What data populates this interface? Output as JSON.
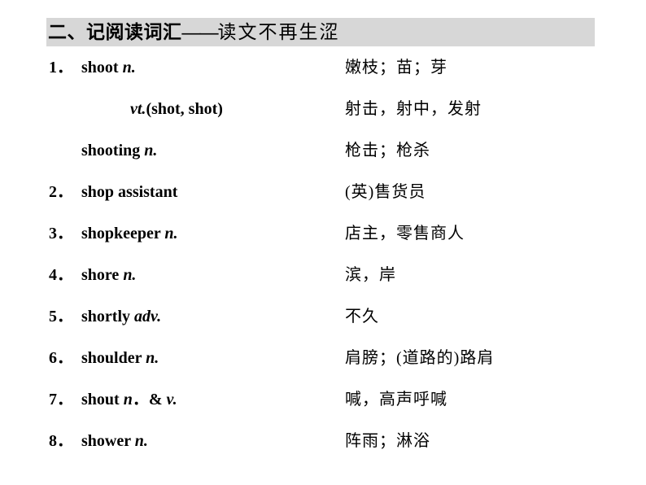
{
  "slide": {
    "title": {
      "head": "二、记阅读词汇",
      "dash": "——",
      "tail": "读文不再生涩",
      "band_color": "#d7d7d7"
    },
    "entries": [
      {
        "number": "1．",
        "english_word": "shoot",
        "part_of_speech": "n.",
        "chinese": "嫩枝；苗；芽"
      },
      {
        "number": "",
        "english_word": "",
        "part_of_speech": "vt.",
        "extra": "(shot, shot)",
        "chinese": "射击，射中，发射"
      },
      {
        "number": "",
        "english_word": "shooting",
        "part_of_speech": "n.",
        "chinese": "枪击；枪杀"
      },
      {
        "number": "2．",
        "english_word": "shop assistant",
        "part_of_speech": "",
        "chinese": "(英)售货员"
      },
      {
        "number": "3．",
        "english_word": "shopkeeper",
        "part_of_speech": "n.",
        "chinese": "店主，零售商人"
      },
      {
        "number": "4．",
        "english_word": "shore",
        "part_of_speech": "n.",
        "chinese": "滨，岸"
      },
      {
        "number": "5．",
        "english_word": "shortly",
        "part_of_speech": "adv.",
        "chinese": "不久"
      },
      {
        "number": "6．",
        "english_word": "shoulder",
        "part_of_speech": "n.",
        "chinese": "肩膀；(道路的)路肩"
      },
      {
        "number": "7．",
        "english_word": "shout",
        "part_of_speech": "n",
        "extra2": "．&",
        "part_of_speech2": "v.",
        "chinese": "喊，高声呼喊"
      },
      {
        "number": "8．",
        "english_word": "shower",
        "part_of_speech": "n.",
        "chinese": "阵雨；淋浴"
      }
    ]
  }
}
